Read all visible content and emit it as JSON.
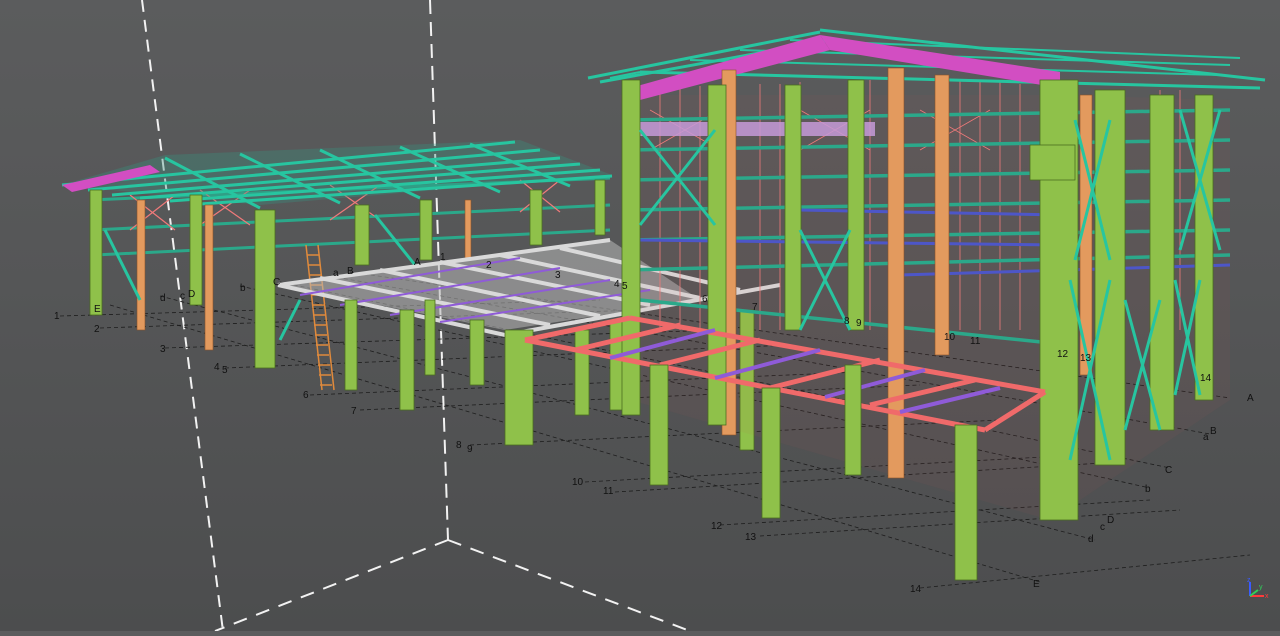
{
  "viewport": {
    "background_top": "#5b5c5d",
    "background_bottom": "#4c4d4e"
  },
  "colors": {
    "column": "#8fc14a",
    "column_dark": "#5f8b2a",
    "column_orange": "#e39a5e",
    "purlin": "#27c5a0",
    "girt": "#2ba88a",
    "rafter": "#d24ec2",
    "bracing": "#f07a7a",
    "beam_red": "#f06a6a",
    "beam_grey": "#c8c8c8",
    "beam_purple": "#8f5bd8",
    "beam_blue": "#4d56c8"
  },
  "grid_labels": {
    "near": [
      "1",
      "2",
      "3",
      "4",
      "5",
      "6",
      "7",
      "8",
      "9",
      "10",
      "11",
      "12",
      "13",
      "14"
    ],
    "right": [
      "A",
      "B",
      "a",
      "C",
      "b",
      "D",
      "c",
      "d",
      "E"
    ],
    "left": [
      "E",
      "d",
      "c",
      "D",
      "b",
      "C",
      "a",
      "B",
      "A"
    ],
    "deck": [
      "A",
      "1",
      "2",
      "3",
      "4",
      "5",
      "6",
      "7",
      "8",
      "9",
      "10",
      "11",
      "12",
      "13",
      "14"
    ]
  },
  "view_cube": {
    "icon": "axis-triad-icon",
    "x": "x",
    "y": "y",
    "z": "z"
  }
}
